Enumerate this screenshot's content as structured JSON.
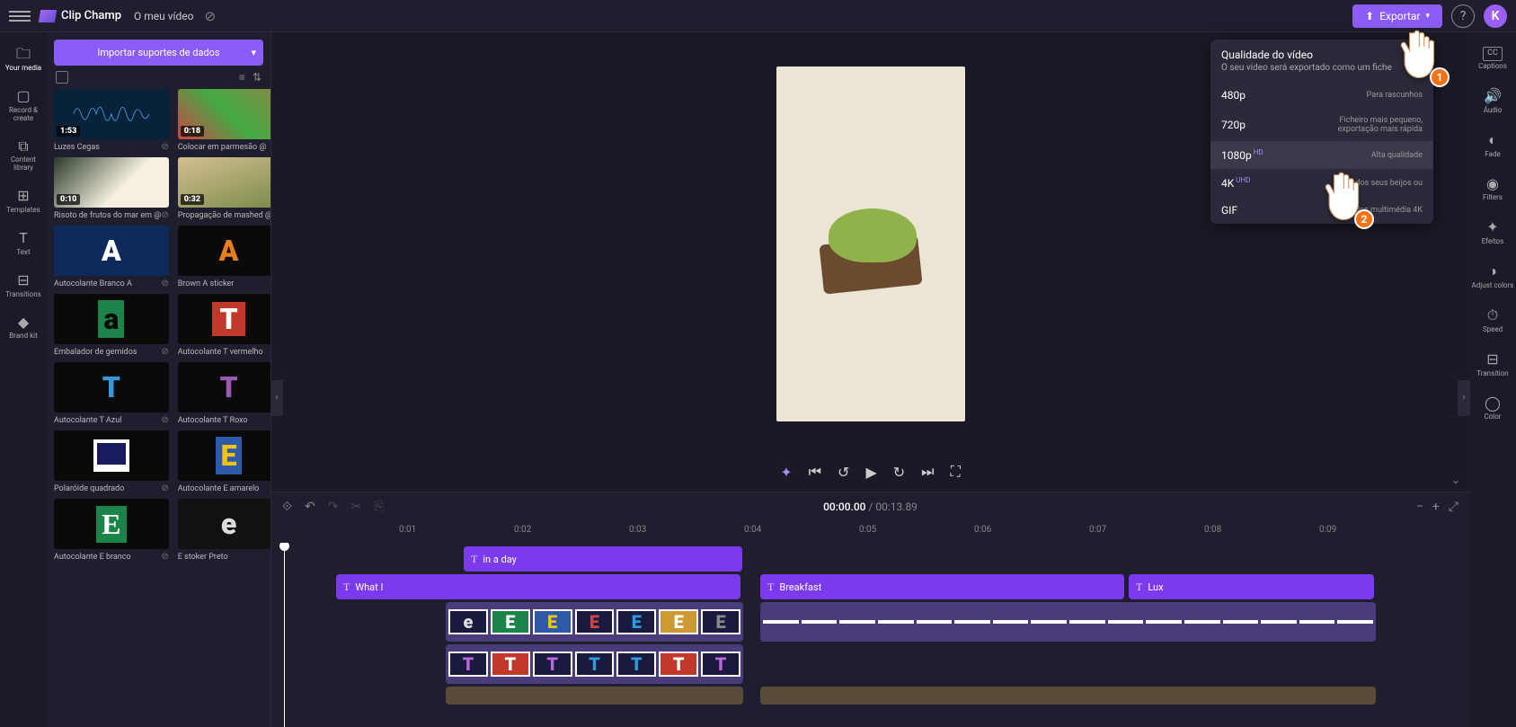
{
  "app_name": "Clip Champ",
  "project_title": "O meu vídeo",
  "export_button": "Exportar",
  "avatar_initial": "K",
  "left_rail": [
    {
      "label": "Your media"
    },
    {
      "label": "Record & create"
    },
    {
      "label": "Content library"
    },
    {
      "label": "Templates"
    },
    {
      "label": "Text"
    },
    {
      "label": "Transitions"
    },
    {
      "label": "Brand kit"
    }
  ],
  "import_button": "Importar suportes de dados",
  "media": [
    {
      "label": "Luzes Cegas",
      "dur": "1:53",
      "style": "audio"
    },
    {
      "label": "Colocar em parmesão @",
      "dur": "0:18",
      "style": "food1"
    },
    {
      "label": "Risoto de frutos do mar em @",
      "dur": "0:10",
      "style": "food2"
    },
    {
      "label": "Propagação de mashed @",
      "dur": "0:32",
      "style": "food3"
    },
    {
      "label": "Autocolante Branco A",
      "style": "letter-A-white",
      "glyph": "A"
    },
    {
      "label": "Brown A sticker",
      "style": "letter-A-brown",
      "glyph": "A"
    },
    {
      "label": "Embalador de gemidos",
      "style": "letter-a-green",
      "glyph": "a"
    },
    {
      "label": "Autocolante T vermelho",
      "style": "letter-T-red",
      "glyph": "T"
    },
    {
      "label": "Autocolante T Azul",
      "style": "letter-T-blue",
      "glyph": "T"
    },
    {
      "label": "Autocolante T Roxo",
      "style": "letter-T-purple",
      "glyph": "T"
    },
    {
      "label": "Polaróide quadrado",
      "style": "polaroid",
      "glyph": ""
    },
    {
      "label": "Autocolante E amarelo",
      "style": "letter-E-yellow",
      "glyph": "E"
    },
    {
      "label": "Autocolante E branco",
      "style": "letter-E-white",
      "glyph": "E"
    },
    {
      "label": "E stoker Preto",
      "style": "letter-e-black",
      "glyph": "e"
    }
  ],
  "timeline": {
    "current": "00:00.00",
    "total": "00:13.89",
    "ruler": [
      "0:01",
      "0:02",
      "0:03",
      "0:04",
      "0:05",
      "0:06",
      "0:07",
      "0:08",
      "0:09"
    ],
    "clips": {
      "text1": "in a day",
      "text2": "What I",
      "text3": "Breakfast",
      "text4": "Lux"
    }
  },
  "right_rail": [
    {
      "label": "Captions"
    },
    {
      "label": "Áudio"
    },
    {
      "label": "Fade"
    },
    {
      "label": "Filters"
    },
    {
      "label": "Efeitos"
    },
    {
      "label": "Adjust colors"
    },
    {
      "label": "Speed"
    },
    {
      "label": "Transition"
    },
    {
      "label": "Color"
    }
  ],
  "export_popup": {
    "title": "Qualidade do vídeo",
    "subtitle": "O seu vídeo será exportado como um fiche",
    "options": [
      {
        "label": "480p",
        "right": "Para rascunhos"
      },
      {
        "label": "720p",
        "right": "Ficheiro mais pequeno, exportação mais rápida"
      },
      {
        "label": "1080p",
        "badge": "HD",
        "right": "Alta qualidade",
        "hl": true
      },
      {
        "label": "4K",
        "badge": "UHD",
        "right": "most dos seus beijos ou"
      },
      {
        "label": "GIF",
        "right": "segundos multimédia 4K"
      }
    ]
  }
}
